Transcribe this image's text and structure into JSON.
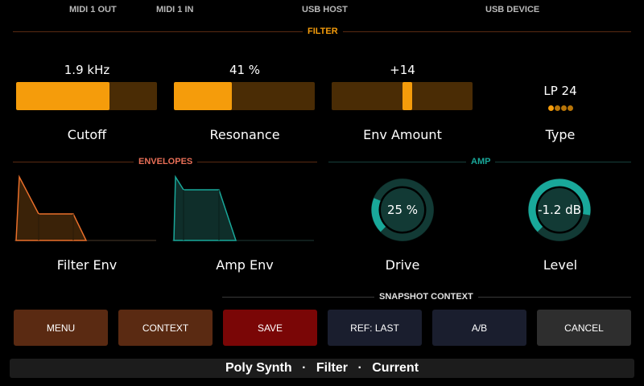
{
  "status_bar": {
    "midi1_out": "MIDI 1 OUT",
    "midi1_in": "MIDI 1 IN",
    "usb_host": "USB HOST",
    "usb_device": "USB DEVICE"
  },
  "sections": {
    "filter": "FILTER",
    "envelopes": "ENVELOPES",
    "amp": "AMP",
    "snapshot": "SNAPSHOT CONTEXT"
  },
  "colors": {
    "orange": "#f59c0b",
    "orange_dark": "#4a2c05",
    "teal": "#19a89a",
    "teal_dark": "#0f2e2a",
    "env_orange_line": "#e96f2a",
    "divider_orange": "#5a2a12",
    "divider_teal": "#16403b"
  },
  "params": {
    "cutoff": {
      "value": "1.9 kHz",
      "label": "Cutoff",
      "fill_fraction": 0.66
    },
    "resonance": {
      "value": "41 %",
      "label": "Resonance",
      "fill_fraction": 0.41
    },
    "env_amount": {
      "value": "+14",
      "label": "Env Amount",
      "fill_fraction": 0.14
    },
    "type": {
      "value": "LP 24",
      "label": "Type",
      "selected_index": 0,
      "option_count": 4
    }
  },
  "envelopes": {
    "filter_env": {
      "label": "Filter Env"
    },
    "amp_env": {
      "label": "Amp Env"
    }
  },
  "amp": {
    "drive": {
      "value": "25 %",
      "label": "Drive",
      "fraction": 0.25
    },
    "level": {
      "value": "-1.2 dB",
      "label": "Level",
      "fraction": 0.87
    }
  },
  "buttons": {
    "menu": "MENU",
    "context": "CONTEXT",
    "save": "SAVE",
    "ref_last": "REF: LAST",
    "ab": "A/B",
    "cancel": "CANCEL"
  },
  "footer": {
    "synth": "Poly Synth",
    "sep1": "·",
    "page": "Filter",
    "sep2": "·",
    "state": "Current"
  }
}
